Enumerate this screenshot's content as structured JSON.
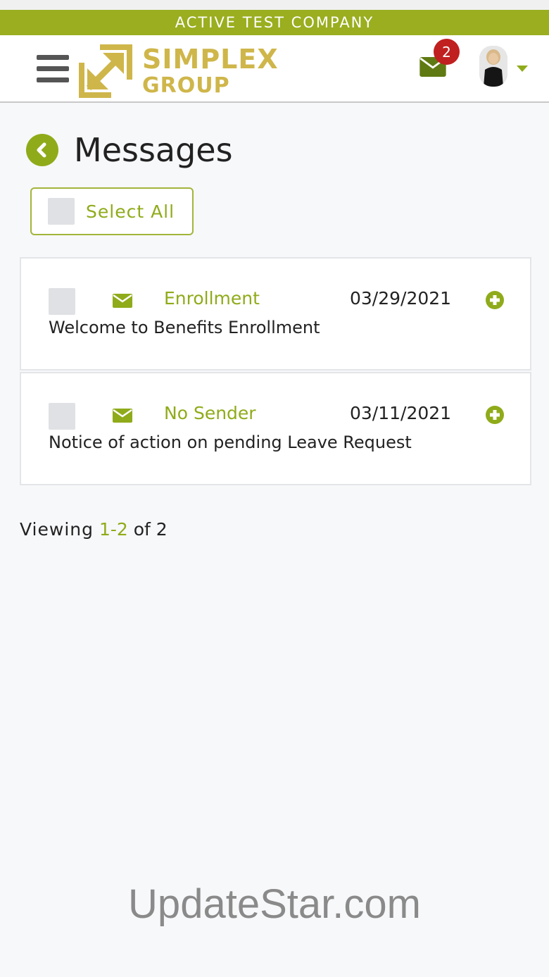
{
  "company_banner": "ACTIVE TEST COMPANY",
  "logo": {
    "line1": "SIMPLEX",
    "line2": "GROUP",
    "color": "#cfb64a"
  },
  "header": {
    "menu_icon": "hamburger-icon",
    "mail_icon": "envelope-icon",
    "unread_count": "2",
    "avatar_icon": "user-avatar",
    "dropdown_icon": "caret-down-icon"
  },
  "page": {
    "back_icon": "chevron-left-circle-icon",
    "title": "Messages"
  },
  "select_all": {
    "label": "Select All"
  },
  "messages": [
    {
      "sender": "Enrollment",
      "date": "03/29/2021",
      "subject": "Welcome to Benefits Enrollment",
      "icon": "envelope-icon",
      "expand_icon": "plus-circle-icon"
    },
    {
      "sender": "No Sender",
      "date": "03/11/2021",
      "subject": "Notice of action on pending Leave Request",
      "icon": "envelope-icon",
      "expand_icon": "plus-circle-icon"
    }
  ],
  "pagination": {
    "prefix": "Viewing",
    "range": "1-2",
    "suffix": "of 2"
  },
  "watermark": "UpdateStar.com",
  "colors": {
    "accent": "#8fab1a",
    "banner": "#9aae1f",
    "badge": "#c0201f"
  }
}
